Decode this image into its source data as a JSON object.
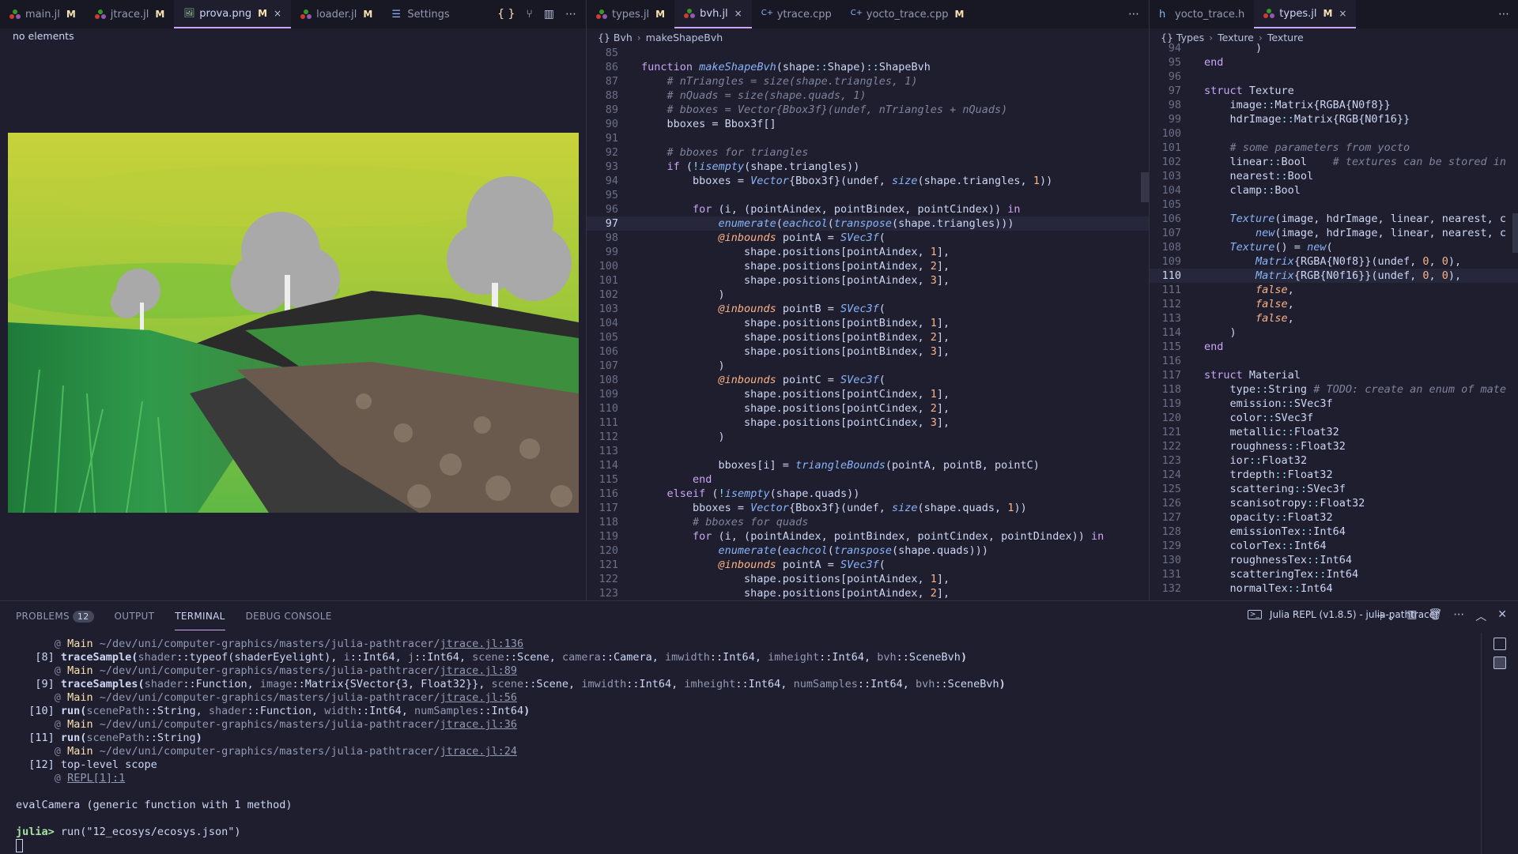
{
  "left_pane": {
    "tabs": [
      {
        "label": "main.jl",
        "type": "julia",
        "modified": "M"
      },
      {
        "label": "jtrace.jl",
        "type": "julia",
        "modified": "M"
      },
      {
        "label": "prova.png",
        "type": "image",
        "modified": "M",
        "active": true,
        "close": "×"
      },
      {
        "label": "loader.jl",
        "type": "julia",
        "modified": "M"
      },
      {
        "label": "Settings",
        "type": "settings"
      }
    ],
    "status": "no elements"
  },
  "middle_pane": {
    "tabs": [
      {
        "label": "types.jl",
        "type": "julia",
        "modified": "M"
      },
      {
        "label": "bvh.jl",
        "type": "julia",
        "active": true,
        "close": "×"
      },
      {
        "label": "ytrace.cpp",
        "type": "cpp"
      },
      {
        "label": "yocto_trace.cpp",
        "type": "cpp",
        "modified": "M"
      }
    ],
    "breadcrumb": [
      "{} Bvh",
      "makeShapeBvh"
    ],
    "current_line": 97,
    "lines": [
      {
        "n": 85,
        "h": ""
      },
      {
        "n": 86,
        "h": "<span class='k'>function</span> <span class='f'>makeShapeBvh</span>(shape<span class='op'>::</span>Shape)<span class='op'>::</span>ShapeBvh"
      },
      {
        "n": 87,
        "h": "    <span class='c'># nTriangles = size(shape.triangles, 1)</span>"
      },
      {
        "n": 88,
        "h": "    <span class='c'># nQuads = size(shape.quads, 1)</span>"
      },
      {
        "n": 89,
        "h": "    <span class='c'># bboxes = Vector{Bbox3f}(undef, nTriangles + nQuads)</span>"
      },
      {
        "n": 90,
        "h": "    bboxes = Bbox3f[]"
      },
      {
        "n": 91,
        "h": ""
      },
      {
        "n": 92,
        "h": "    <span class='c'># bboxes for triangles</span>"
      },
      {
        "n": 93,
        "h": "    <span class='k'>if</span> (<span class='op'>!</span><span class='f'>isempty</span>(shape.triangles))"
      },
      {
        "n": 94,
        "h": "        bboxes = <span class='f'>Vector</span>{Bbox3f}(undef, <span class='f'>size</span>(shape.triangles, <span class='n'>1</span>))"
      },
      {
        "n": 95,
        "h": ""
      },
      {
        "n": 96,
        "h": "        <span class='k'>for</span> (i, (pointAindex, pointBindex, pointCindex)) <span class='k'>in</span>"
      },
      {
        "n": 97,
        "h": "            <span class='f'>enumerate</span>(<span class='f'>eachcol</span>(<span class='f'>transpose</span>(shape.triangles)))"
      },
      {
        "n": 98,
        "h": "            <span class='m'>@inbounds</span> pointA = <span class='f'>SVec3f</span>("
      },
      {
        "n": 99,
        "h": "                shape.positions[pointAindex, <span class='n'>1</span>],"
      },
      {
        "n": 100,
        "h": "                shape.positions[pointAindex, <span class='n'>2</span>],"
      },
      {
        "n": 101,
        "h": "                shape.positions[pointAindex, <span class='n'>3</span>],"
      },
      {
        "n": 102,
        "h": "            )"
      },
      {
        "n": 103,
        "h": "            <span class='m'>@inbounds</span> pointB = <span class='f'>SVec3f</span>("
      },
      {
        "n": 104,
        "h": "                shape.positions[pointBindex, <span class='n'>1</span>],"
      },
      {
        "n": 105,
        "h": "                shape.positions[pointBindex, <span class='n'>2</span>],"
      },
      {
        "n": 106,
        "h": "                shape.positions[pointBindex, <span class='n'>3</span>],"
      },
      {
        "n": 107,
        "h": "            )"
      },
      {
        "n": 108,
        "h": "            <span class='m'>@inbounds</span> pointC = <span class='f'>SVec3f</span>("
      },
      {
        "n": 109,
        "h": "                shape.positions[pointCindex, <span class='n'>1</span>],"
      },
      {
        "n": 110,
        "h": "                shape.positions[pointCindex, <span class='n'>2</span>],"
      },
      {
        "n": 111,
        "h": "                shape.positions[pointCindex, <span class='n'>3</span>],"
      },
      {
        "n": 112,
        "h": "            )"
      },
      {
        "n": 113,
        "h": ""
      },
      {
        "n": 114,
        "h": "            bboxes[i] = <span class='f'>triangleBounds</span>(pointA, pointB, pointC)"
      },
      {
        "n": 115,
        "h": "        <span class='k'>end</span>"
      },
      {
        "n": 116,
        "h": "    <span class='k'>elseif</span> (<span class='op'>!</span><span class='f'>isempty</span>(shape.quads))"
      },
      {
        "n": 117,
        "h": "        bboxes = <span class='f'>Vector</span>{Bbox3f}(undef, <span class='f'>size</span>(shape.quads, <span class='n'>1</span>))"
      },
      {
        "n": 118,
        "h": "        <span class='c'># bboxes for quads</span>"
      },
      {
        "n": 119,
        "h": "        <span class='k'>for</span> (i, (pointAindex, pointBindex, pointCindex, pointDindex)) <span class='k'>in</span>"
      },
      {
        "n": 120,
        "h": "            <span class='f'>enumerate</span>(<span class='f'>eachcol</span>(<span class='f'>transpose</span>(shape.quads)))"
      },
      {
        "n": 121,
        "h": "            <span class='m'>@inbounds</span> pointA = <span class='f'>SVec3f</span>("
      },
      {
        "n": 122,
        "h": "                shape.positions[pointAindex, <span class='n'>1</span>],"
      },
      {
        "n": 123,
        "h": "                shape.positions[pointAindex, <span class='n'>2</span>],"
      }
    ]
  },
  "right_pane": {
    "tabs": [
      {
        "label": "yocto_trace.h",
        "type": "h"
      },
      {
        "label": "types.jl",
        "type": "julia",
        "modified": "M",
        "active": true,
        "close": "×"
      }
    ],
    "breadcrumb": [
      "{} Types",
      "Texture",
      "Texture"
    ],
    "current_line": 110,
    "lines": [
      {
        "n": 94,
        "h": "        )"
      },
      {
        "n": 95,
        "h": "<span class='k'>end</span>"
      },
      {
        "n": 96,
        "h": ""
      },
      {
        "n": 97,
        "h": "<span class='k'>struct</span> Texture"
      },
      {
        "n": 98,
        "h": "    image<span class='op'>::</span>Matrix{RGBA{N0f8}}"
      },
      {
        "n": 99,
        "h": "    hdrImage<span class='op'>::</span>Matrix{RGB{N0f16}}"
      },
      {
        "n": 100,
        "h": ""
      },
      {
        "n": 101,
        "h": "    <span class='c'># some parameters from yocto</span>"
      },
      {
        "n": 102,
        "h": "    linear<span class='op'>::</span>Bool    <span class='c'># textures can be stored in</span>"
      },
      {
        "n": 103,
        "h": "    nearest<span class='op'>::</span>Bool"
      },
      {
        "n": 104,
        "h": "    clamp<span class='op'>::</span>Bool"
      },
      {
        "n": 105,
        "h": ""
      },
      {
        "n": 106,
        "h": "    <span class='f'>Texture</span>(image, hdrImage, linear, nearest, c"
      },
      {
        "n": 107,
        "h": "        <span class='f'>new</span>(image, hdrImage, linear, nearest, c"
      },
      {
        "n": 108,
        "h": "    <span class='f'>Texture</span>() = <span class='f'>new</span>("
      },
      {
        "n": 109,
        "h": "        <span class='f'>Matrix</span>{RGBA{N0f8}}(undef, <span class='n'>0</span>, <span class='n'>0</span>),"
      },
      {
        "n": 110,
        "h": "        <span class='f'>Matrix</span>{RGB{N0f16}}(undef, <span class='n'>0</span>, <span class='n'>0</span>),"
      },
      {
        "n": 111,
        "h": "        <span class='b'>false</span>,"
      },
      {
        "n": 112,
        "h": "        <span class='b'>false</span>,"
      },
      {
        "n": 113,
        "h": "        <span class='b'>false</span>,"
      },
      {
        "n": 114,
        "h": "    )"
      },
      {
        "n": 115,
        "h": "<span class='k'>end</span>"
      },
      {
        "n": 116,
        "h": ""
      },
      {
        "n": 117,
        "h": "<span class='k'>struct</span> Material"
      },
      {
        "n": 118,
        "h": "    type<span class='op'>::</span>String <span class='c'># TODO: create an enum of mate</span>"
      },
      {
        "n": 119,
        "h": "    emission<span class='op'>::</span>SVec3f"
      },
      {
        "n": 120,
        "h": "    color<span class='op'>::</span>SVec3f"
      },
      {
        "n": 121,
        "h": "    metallic<span class='op'>::</span>Float32"
      },
      {
        "n": 122,
        "h": "    roughness<span class='op'>::</span>Float32"
      },
      {
        "n": 123,
        "h": "    ior<span class='op'>::</span>Float32"
      },
      {
        "n": 124,
        "h": "    trdepth<span class='op'>::</span>Float32"
      },
      {
        "n": 125,
        "h": "    scattering<span class='op'>::</span>SVec3f"
      },
      {
        "n": 126,
        "h": "    scanisotropy<span class='op'>::</span>Float32"
      },
      {
        "n": 127,
        "h": "    opacity<span class='op'>::</span>Float32"
      },
      {
        "n": 128,
        "h": "    emissionTex<span class='op'>::</span>Int64"
      },
      {
        "n": 129,
        "h": "    colorTex<span class='op'>::</span>Int64"
      },
      {
        "n": 130,
        "h": "    roughnessTex<span class='op'>::</span>Int64"
      },
      {
        "n": 131,
        "h": "    scatteringTex<span class='op'>::</span>Int64"
      },
      {
        "n": 132,
        "h": "    normalTex<span class='op'>::</span>Int64"
      }
    ]
  },
  "panel": {
    "tabs": [
      {
        "label": "PROBLEMS",
        "badge": "12"
      },
      {
        "label": "OUTPUT"
      },
      {
        "label": "TERMINAL",
        "active": true
      },
      {
        "label": "DEBUG CONSOLE"
      }
    ],
    "terminal_title": "Julia REPL (v1.8.5) - julia-pathtracer",
    "lines": [
      {
        "h": "      <span class='c' style='font-style:normal'>@</span> <span class='t'>Main</span> <span style='color:#9399b2'>~/dev/uni/computer-graphics/masters/julia-pathtracer/</span><span class='u'>jtrace.jl:136</span>"
      },
      {
        "h": "   [8] <b>traceSample(</b><span style='color:#9399b2'>shader</span>::typeof(shaderEyelight), <span style='color:#9399b2'>i</span>::Int64, <span style='color:#9399b2'>j</span>::Int64, <span style='color:#9399b2'>scene</span>::Scene, <span style='color:#9399b2'>camera</span>::Camera, <span style='color:#9399b2'>imwidth</span>::Int64, <span style='color:#9399b2'>imheight</span>::Int64, <span style='color:#9399b2'>bvh</span>::SceneBvh<b>)</b>"
      },
      {
        "h": "      <span class='c' style='font-style:normal'>@</span> <span class='t'>Main</span> <span style='color:#9399b2'>~/dev/uni/computer-graphics/masters/julia-pathtracer/</span><span class='u'>jtrace.jl:89</span>"
      },
      {
        "h": "   [9] <b>traceSamples(</b><span style='color:#9399b2'>shader</span>::Function, <span style='color:#9399b2'>image</span>::Matrix{SVector{3, Float32}}, <span style='color:#9399b2'>scene</span>::Scene, <span style='color:#9399b2'>imwidth</span>::Int64, <span style='color:#9399b2'>imheight</span>::Int64, <span style='color:#9399b2'>numSamples</span>::Int64, <span style='color:#9399b2'>bvh</span>::SceneBvh<b>)</b>"
      },
      {
        "h": "      <span class='c' style='font-style:normal'>@</span> <span class='t'>Main</span> <span style='color:#9399b2'>~/dev/uni/computer-graphics/masters/julia-pathtracer/</span><span class='u'>jtrace.jl:56</span>"
      },
      {
        "h": "  [10] <b>run(</b><span style='color:#9399b2'>scenePath</span>::String, <span style='color:#9399b2'>shader</span>::Function, <span style='color:#9399b2'>width</span>::Int64, <span style='color:#9399b2'>numSamples</span>::Int64<b>)</b>"
      },
      {
        "h": "      <span class='c' style='font-style:normal'>@</span> <span class='t'>Main</span> <span style='color:#9399b2'>~/dev/uni/computer-graphics/masters/julia-pathtracer/</span><span class='u'>jtrace.jl:36</span>"
      },
      {
        "h": "  [11] <b>run(</b><span style='color:#9399b2'>scenePath</span>::String<b>)</b>"
      },
      {
        "h": "      <span class='c' style='font-style:normal'>@</span> <span class='t'>Main</span> <span style='color:#9399b2'>~/dev/uni/computer-graphics/masters/julia-pathtracer/</span><span class='u'>jtrace.jl:24</span>"
      },
      {
        "h": "  [12] top-level scope"
      },
      {
        "h": "      <span class='c' style='font-style:normal'>@</span> <span class='u'>REPL[1]:1</span>"
      },
      {
        "h": ""
      },
      {
        "h": "evalCamera (generic function with 1 method)"
      },
      {
        "h": ""
      },
      {
        "h": "<span style='color:#a6e3a1;font-weight:bold'>julia&gt;</span> run(\"12_ecosys/ecosys.json\")"
      }
    ]
  }
}
